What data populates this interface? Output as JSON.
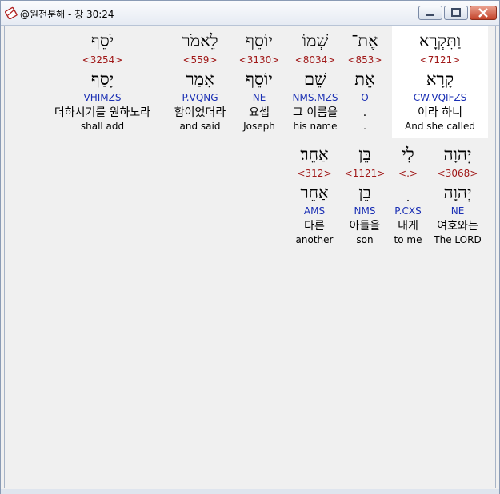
{
  "window": {
    "title": "@원전분해 - 창 30:24"
  },
  "icons": {
    "app": "bible-app-icon",
    "minimize": "minimize-icon",
    "maximize": "maximize-icon",
    "close": "close-icon"
  },
  "row1": [
    {
      "hebrew": "וַתִּקְרָא",
      "strong": "<7121>",
      "lemma": "קָרָא",
      "morph": "CW.VQIFZS",
      "korean": "이라 하니",
      "english": "And she called"
    },
    {
      "hebrew": "אֶת־",
      "strong": "<853>",
      "lemma": "אֵת",
      "morph": "O",
      "korean": ".",
      "english": "."
    },
    {
      "hebrew": "שְׁמוֹ",
      "strong": "<8034>",
      "lemma": "שֵׁם",
      "morph": "NMS.MZS",
      "korean": "그 이름을",
      "english": "his name"
    },
    {
      "hebrew": "יוֹסֵף",
      "strong": "<3130>",
      "lemma": "יוֹסֵף",
      "morph": "NE",
      "korean": "요셉",
      "english": "Joseph"
    },
    {
      "hebrew": "לֵאמֹר",
      "strong": "<559>",
      "lemma": "אָמַר",
      "morph": "P.VQNG",
      "korean": "함이었더라",
      "english": "and said"
    },
    {
      "hebrew": "יֹסֵף",
      "strong": "<3254>",
      "lemma": "יָסַף",
      "morph": "VHIMZS",
      "korean": "더하시기를 원하노라",
      "english": "shall add"
    }
  ],
  "row2": [
    {
      "hebrew": "יְהוָה",
      "strong": "<3068>",
      "lemma": "יְהוָה",
      "morph": "NE",
      "korean": "여호와는",
      "english": "The LORD"
    },
    {
      "hebrew": "לִי",
      "strong": "<.>",
      "lemma": "ִ",
      "morph": "P.CXS",
      "korean": "내게",
      "english": "to me"
    },
    {
      "hebrew": "בֵּן",
      "strong": "<1121>",
      "lemma": "בֵּן",
      "morph": "NMS",
      "korean": "아들을",
      "english": "son"
    },
    {
      "hebrew": "אַחֵר׃",
      "strong": "<312>",
      "lemma": "אַחֵר",
      "morph": "AMS",
      "korean": "다른",
      "english": "another"
    }
  ]
}
